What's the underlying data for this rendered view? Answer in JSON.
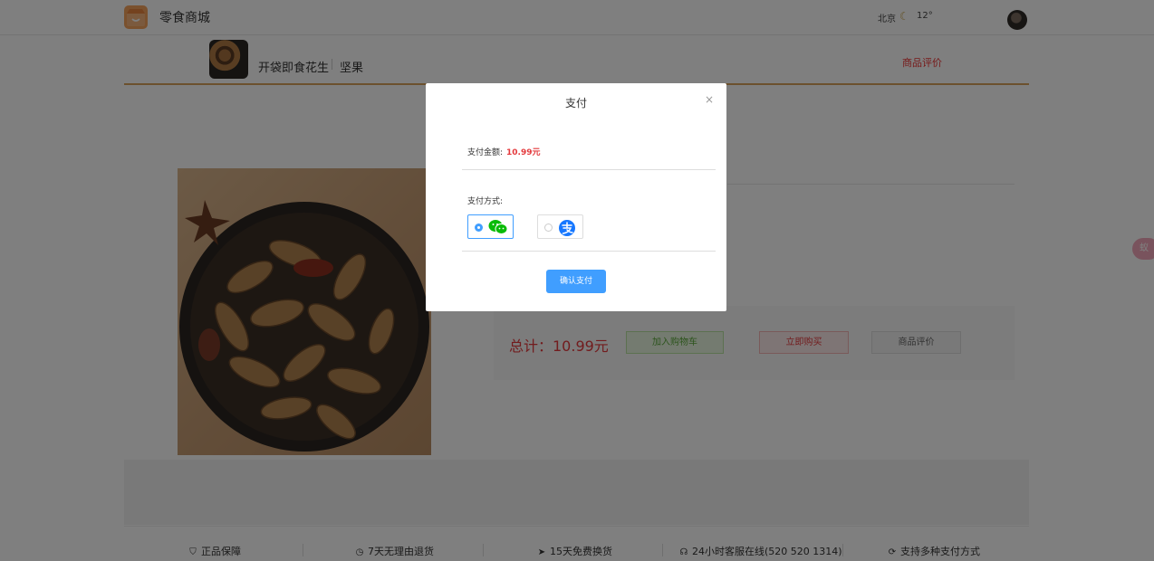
{
  "header": {
    "brand": "零食商城",
    "city": "北京",
    "weather_icon": "moon-icon",
    "temperature": "12°"
  },
  "product_header": {
    "name": "开袋即食花生",
    "category": "坚果",
    "review_link": "商品评价"
  },
  "product": {
    "total_label": "总计：10.99元",
    "buttons": {
      "add_to_cart": "加入购物车",
      "buy_now": "立即购买",
      "review": "商品评价"
    }
  },
  "side_tab": {
    "label": "蚁"
  },
  "footer": {
    "features": [
      {
        "icon": "badge-icon",
        "label": "正品保障"
      },
      {
        "icon": "clock-icon",
        "label": "7天无理由退货"
      },
      {
        "icon": "send-icon",
        "label": "15天免费换货"
      },
      {
        "icon": "headset-icon",
        "label": "24小时客服在线(520 520 1314)"
      },
      {
        "icon": "refresh-icon",
        "label": "支持多种支付方式"
      }
    ]
  },
  "modal": {
    "title": "支付",
    "close_label": "×",
    "amount_label": "支付金额:",
    "amount_value": "10.99元",
    "method_label": "支付方式:",
    "methods": [
      {
        "name": "wechat-pay",
        "icon": "wechat-icon",
        "selected": true
      },
      {
        "name": "alipay",
        "icon": "alipay-icon",
        "selected": false
      }
    ],
    "confirm_label": "确认支付"
  },
  "colors": {
    "accent": "#409eff",
    "price_red": "#e4393c",
    "brand_orange": "#f5a25d",
    "wechat_green": "#09bb07",
    "alipay_blue": "#1677ff"
  }
}
